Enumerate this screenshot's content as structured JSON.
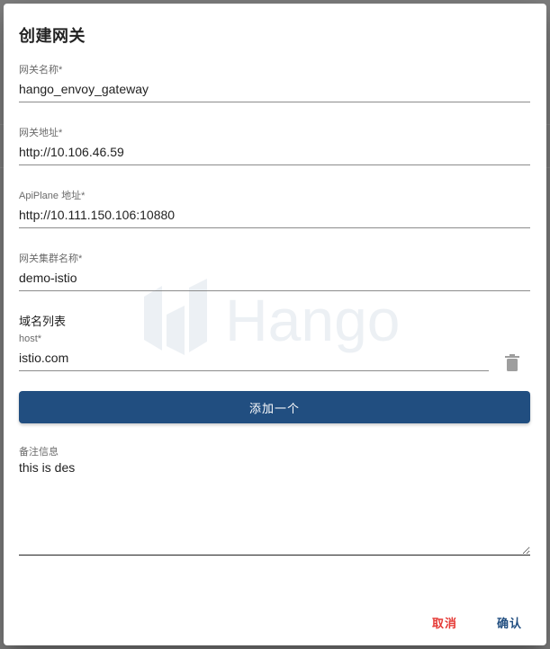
{
  "dialog": {
    "title": "创建网关"
  },
  "watermark": {
    "logo_text": "Hango"
  },
  "fields": {
    "gateway_name": {
      "label": "网关名称*",
      "value": "hango_envoy_gateway"
    },
    "gateway_address": {
      "label": "网关地址*",
      "value": "http://10.106.46.59"
    },
    "apiplane_address": {
      "label": "ApiPlane 地址*",
      "value": "http://10.111.150.106:10880"
    },
    "cluster_name": {
      "label": "网关集群名称*",
      "value": "demo-istio"
    }
  },
  "domains": {
    "section_label": "域名列表",
    "items": [
      {
        "label": "host*",
        "value": "istio.com"
      }
    ],
    "add_label": "添加一个"
  },
  "notes": {
    "label": "备注信息",
    "value": "this is des"
  },
  "actions": {
    "cancel_label": "取消",
    "confirm_label": "确认",
    "cancel_color": "#e53935",
    "confirm_color": "#214e80"
  },
  "colors": {
    "primary": "#214e80",
    "overlay": "#7f7f7f"
  }
}
